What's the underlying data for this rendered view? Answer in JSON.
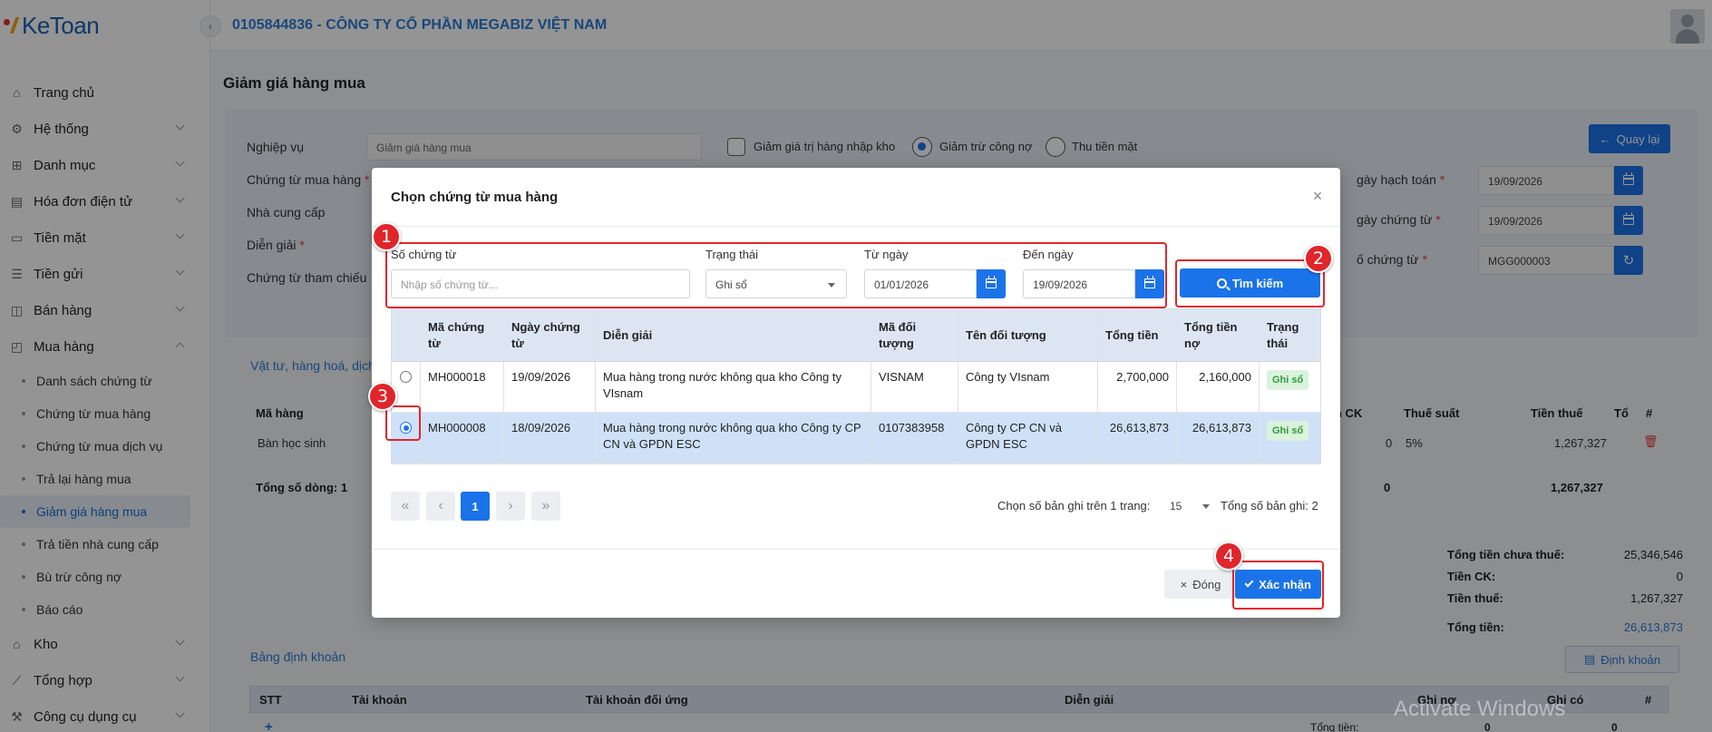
{
  "app": {
    "logo_text": "KeToan",
    "company": "0105844836 - CÔNG TY CỔ PHẦN MEGABIZ VIỆT NAM"
  },
  "sidebar": {
    "items": [
      {
        "label": "Trang chủ",
        "icon": "home-icon"
      },
      {
        "label": "Hệ thống",
        "icon": "gear-icon"
      },
      {
        "label": "Danh mục",
        "icon": "grid-icon"
      },
      {
        "label": "Hóa đơn điện tử",
        "icon": "invoice-icon"
      },
      {
        "label": "Tiền mặt",
        "icon": "cash-icon"
      },
      {
        "label": "Tiền gửi",
        "icon": "bank-icon"
      },
      {
        "label": "Bán hàng",
        "icon": "lock-bag-icon"
      },
      {
        "label": "Mua hàng",
        "icon": "cart-icon"
      }
    ],
    "purchase_sub": [
      "Danh sách chứng từ",
      "Chứng từ mua hàng",
      "Chứng từ mua dịch vụ",
      "Trả lại hàng mua",
      "Giảm giá hàng mua",
      "Trả tiền nhà cung cấp",
      "Bù trừ công nợ",
      "Báo cáo"
    ],
    "bottom_items": [
      {
        "label": "Kho",
        "icon": "warehouse-icon"
      },
      {
        "label": "Tổng hợp",
        "icon": "chart-line-icon"
      },
      {
        "label": "Công cụ dụng cụ",
        "icon": "tools-icon"
      }
    ]
  },
  "page": {
    "title": "Giảm giá hàng mua",
    "back_label": "Quay lại",
    "form": {
      "nghiep_vu_label": "Nghiệp vụ",
      "nghiep_vu_value": "Giảm giá hàng mua",
      "opt_nhap_kho": "Giảm giá trị hàng nhập kho",
      "opt_tru_cong_no": "Giảm trừ công nợ",
      "opt_thu_tien": "Thu tiền mặt",
      "chung_tu_mua_label": "Chứng từ mua hàng",
      "nha_cung_cap_label": "Nhà cung cấp",
      "dien_giai_label": "Diễn giải",
      "tham_chieu_label": "Chứng từ tham chiếu",
      "ngay_hach_toan_label": "gày hạch toán",
      "ngay_hach_toan": "19/09/2026",
      "ngay_chung_tu_label": "gày chứng từ",
      "ngay_chung_tu": "19/09/2026",
      "so_chung_tu_label": "ố chứng từ",
      "so_chung_tu": "MGG000003",
      "req": "*"
    },
    "section_items": "Vật tư, hàng hoá, dịch",
    "bg_table": {
      "col_ma_hang": "Mã hàng",
      "col_ck": "n CK",
      "col_thue_suat": "Thuế suất",
      "col_tien_thue": "Tiền thuế",
      "col_t": "Tổ",
      "col_hash": "#",
      "row_ma_hang": "Bàn học sinh",
      "row_ck": "0",
      "row_thue_suat": "5%",
      "row_tien_thue": "1,267,327",
      "total_rows": "Tổng số dòng: 1",
      "total_ck": "0",
      "total_thue": "1,267,327"
    },
    "summary": {
      "chua_thue_label": "Tổng tiền chưa thuế:",
      "chua_thue": "25,346,546",
      "ck_label": "Tiền CK:",
      "ck": "0",
      "thue_label": "Tiền thuế:",
      "thue": "1,267,327",
      "tong_label": "Tổng tiền:",
      "tong": "26,613,873"
    },
    "section_accounts": "Bảng định khoản",
    "dinh_khoan_btn": "Định khoản",
    "acc_table": {
      "stt": "STT",
      "tai_khoan": "Tài khoản",
      "tk_doi_ung": "Tài khoản đối ứng",
      "dien_giai": "Diễn giải",
      "ghi_no": "Ghi nợ",
      "ghi_co": "Ghi có",
      "hash": "#",
      "plus": "+",
      "tong_tien_label": "Tổng tiền:",
      "tong_no": "0",
      "tong_co": "0"
    }
  },
  "modal": {
    "title": "Chọn chứng từ mua hàng",
    "filters": {
      "so_ct_label": "Số chứng từ",
      "so_ct_placeholder": "Nhập số chứng từ...",
      "trang_thai_label": "Trạng thái",
      "trang_thai_value": "Ghi sổ",
      "tu_ngay_label": "Từ ngày",
      "tu_ngay": "01/01/2026",
      "den_ngay_label": "Đến ngày",
      "den_ngay": "19/09/2026"
    },
    "search_label": "Tìm kiếm",
    "columns": [
      "Mã chứng từ",
      "Ngày chứng từ",
      "Diễn giải",
      "Mã đối tượng",
      "Tên đối tượng",
      "Tổng tiền",
      "Tổng tiền nợ",
      "Trạng thái"
    ],
    "rows": [
      {
        "ma": "MH000018",
        "ngay": "19/09/2026",
        "dien_giai": "Mua hàng trong nước không qua kho Công ty VIsnam",
        "ma_dt": "VISNAM",
        "ten_dt": "Công ty VIsnam",
        "tong": "2,700,000",
        "tong_no": "2,160,000",
        "trang_thai": "Ghi sổ",
        "selected": false
      },
      {
        "ma": "MH000008",
        "ngay": "18/09/2026",
        "dien_giai": "Mua hàng trong nước không qua kho Công ty CP CN và GPDN ESC",
        "ma_dt": "0107383958",
        "ten_dt": "Công ty CP CN và GPDN ESC",
        "tong": "26,613,873",
        "tong_no": "26,613,873",
        "trang_thai": "Ghi sổ",
        "selected": true
      }
    ],
    "pager": {
      "current": "1",
      "per_page_label": "Chọn số bản ghi trên 1 trang:",
      "per_page": "15",
      "total_label": "Tổng số bản ghi:",
      "total": "2"
    },
    "close_label": "Đóng",
    "confirm_label": "Xác nhận"
  },
  "annotations": [
    "1",
    "2",
    "3",
    "4"
  ],
  "watermark": "Activate Windows",
  "colors": {
    "primary": "#1a73e8",
    "annotation": "#e0252b",
    "badge_bg": "#d9f3dc",
    "badge_text": "#2f9a3c"
  }
}
